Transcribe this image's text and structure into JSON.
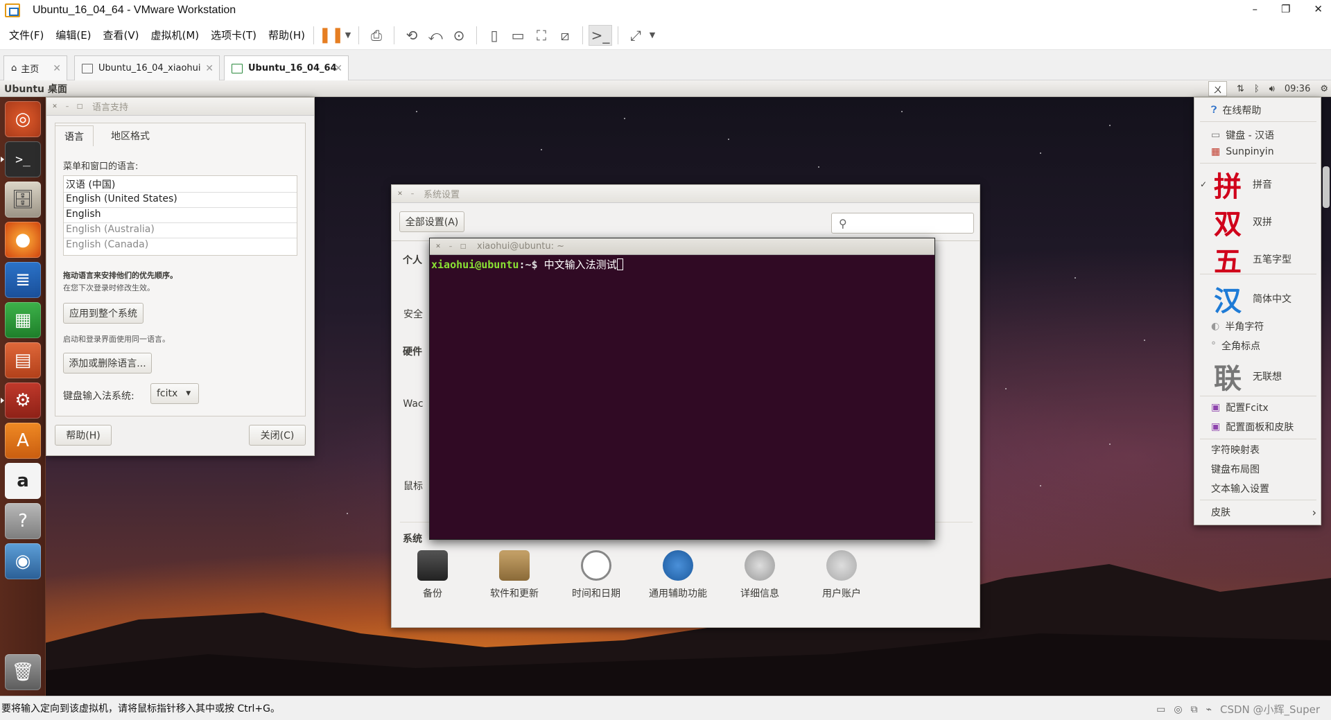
{
  "window": {
    "title": "Ubuntu_16_04_64 - VMware Workstation",
    "min": "–",
    "max": "❐",
    "close": "✕"
  },
  "menu": [
    "文件(F)",
    "编辑(E)",
    "查看(V)",
    "虚拟机(M)",
    "选项卡(T)",
    "帮助(H)"
  ],
  "tabs": [
    {
      "label": "主页"
    },
    {
      "label": "Ubuntu_16_04_xiaohui"
    },
    {
      "label": "Ubuntu_16_04_64"
    }
  ],
  "panel": {
    "title": "Ubuntu 桌面",
    "time": "09:36"
  },
  "lang_window": {
    "title": "语言支持",
    "tabs": [
      "语言",
      "地区格式"
    ],
    "menu_lang_label": "菜单和窗口的语言:",
    "languages": [
      "汉语 (中国)",
      "English (United States)",
      "English",
      "English (Australia)",
      "English (Canada)"
    ],
    "drag_hint": "拖动语言来安排他们的优先顺序。",
    "effect_hint": "在您下次登录时修改生效。",
    "apply_button": "应用到整个系统",
    "login_hint": "启动和登录界面使用同一语言。",
    "add_remove_button": "添加或删除语言...",
    "im_label": "键盘输入法系统:",
    "im_value": "fcitx",
    "help_button": "帮助(H)",
    "close_button": "关闭(C)"
  },
  "settings_window": {
    "title": "系统设置",
    "all_settings": "全部设置(A)",
    "categories": {
      "personal": "个人",
      "hardware": "硬件",
      "system": "系统"
    },
    "partial": {
      "security": "安全",
      "wacom": "Wac",
      "mouse": "鼠标"
    },
    "system_items": [
      "备份",
      "软件和更新",
      "时间和日期",
      "通用辅助功能",
      "详细信息",
      "用户账户"
    ]
  },
  "terminal": {
    "title": "xiaohui@ubuntu: ~",
    "user": "xiaohui@ubuntu",
    "path": ":~$ ",
    "input": "中文输入法测试"
  },
  "fcitx_menu": {
    "help": "在线帮助",
    "keyboard": "键盘 - 汉语",
    "sunpinyin": "Sunpinyin",
    "pinyin_char": "拼",
    "pinyin": "拼音",
    "shuangpin_char": "双",
    "shuangpin": "双拼",
    "wubi_char": "五",
    "wubi": "五笔字型",
    "simp_char": "汉",
    "simp": "简体中文",
    "halfwidth": "半角字符",
    "fullpunct": "全角标点",
    "lian_char": "联",
    "nolian": "无联想",
    "config_fcitx": "配置Fcitx",
    "config_skin": "配置面板和皮肤",
    "charmap": "字符映射表",
    "keyboard_layout": "键盘布局图",
    "text_input": "文本输入设置",
    "skin": "皮肤"
  },
  "status_bar": {
    "message": "要将输入定向到该虚拟机，请将鼠标指针移入其中或按 Ctrl+G。",
    "watermark": "CSDN @小辉_Super"
  },
  "colors": {
    "terminal_bg": "#300a24",
    "prompt_green": "#8ae234",
    "accent_orange": "#e67e22",
    "fcitx_red": "#d0021b",
    "fcitx_blue": "#1e7bd6"
  }
}
